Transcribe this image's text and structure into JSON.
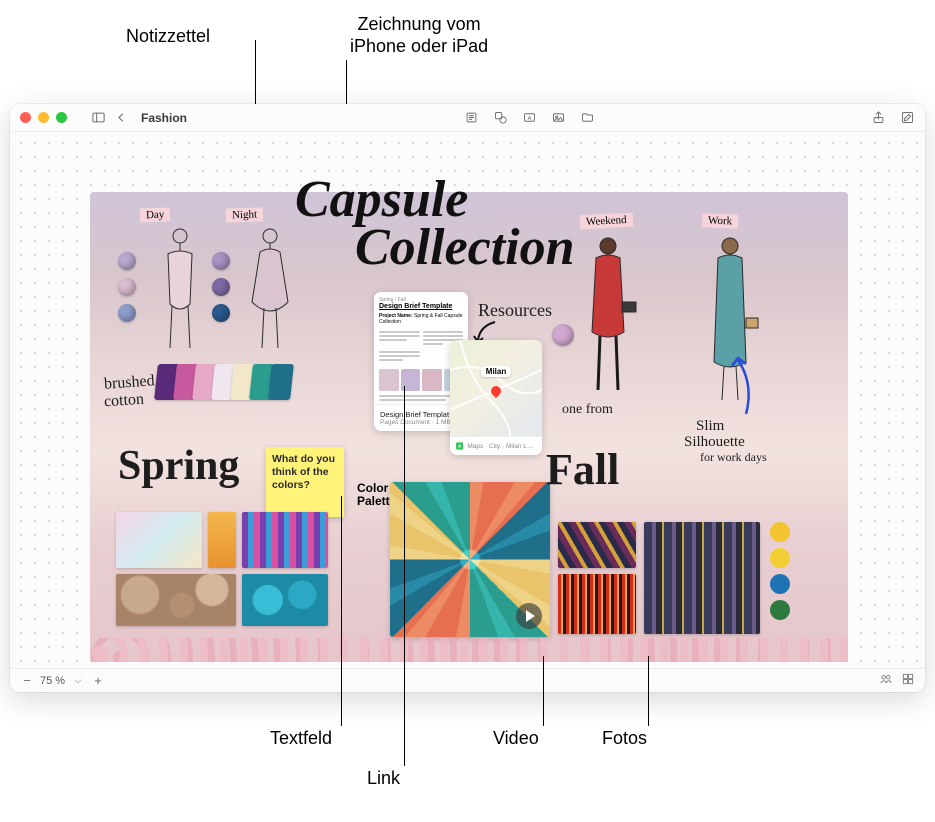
{
  "callouts": {
    "top": {
      "sticky": "Notizzettel",
      "drawing": "Zeichnung vom\niPhone oder iPad"
    },
    "bottom": {
      "textfield": "Textfeld",
      "link": "Link",
      "video": "Video",
      "photos": "Fotos"
    }
  },
  "window": {
    "title": "Fashion"
  },
  "statusbar": {
    "zoom": "75 %"
  },
  "board": {
    "hw_title_line1": "Capsule",
    "hw_title_line2": "Collection",
    "spring": {
      "tag_day": "Day",
      "tag_night": "Night",
      "hw_brushed": "brushed",
      "hw_cotton": "cotton",
      "hw_spring": "Spring"
    },
    "sticky": {
      "text": "What do you think of the colors?"
    },
    "textfield": {
      "line1": "Color",
      "line2": "Palette"
    },
    "link_doc": {
      "crumb": "Spring / Fall",
      "title": "Design Brief Template",
      "project_label": "Project Name:",
      "project_value": "Spring & Fall Capsule Collection",
      "meta_title": "Design Brief Templat…",
      "meta_sub": "Pages Document · 1 MB"
    },
    "map": {
      "pin": "Milan",
      "meta": "Maps · City · Milan Lom…"
    },
    "hw_resources": "Resources",
    "fall": {
      "tag_weekend": "Weekend",
      "tag_work": "Work",
      "hw_fall": "Fall",
      "hw_onefrom": "one from",
      "hw_slim1": "Slim",
      "hw_slim2": "Silhouette",
      "hw_slim3": "for work days"
    }
  },
  "colors": {
    "spring_dots": [
      "#b7a8cf",
      "#d9bcd0",
      "#8e9ecb"
    ],
    "night_dots": [
      "#a893c5",
      "#7d6aa5",
      "#2a5a8f"
    ],
    "palette": [
      "#f08065",
      "#d6b6b6",
      "#e83d8b",
      "#2c9c93"
    ],
    "fall_swatch": "#d1a8cf",
    "fall_palette": [
      "#f2c531",
      "#f3cf33",
      "#1e74b3",
      "#2d7a3e"
    ]
  }
}
